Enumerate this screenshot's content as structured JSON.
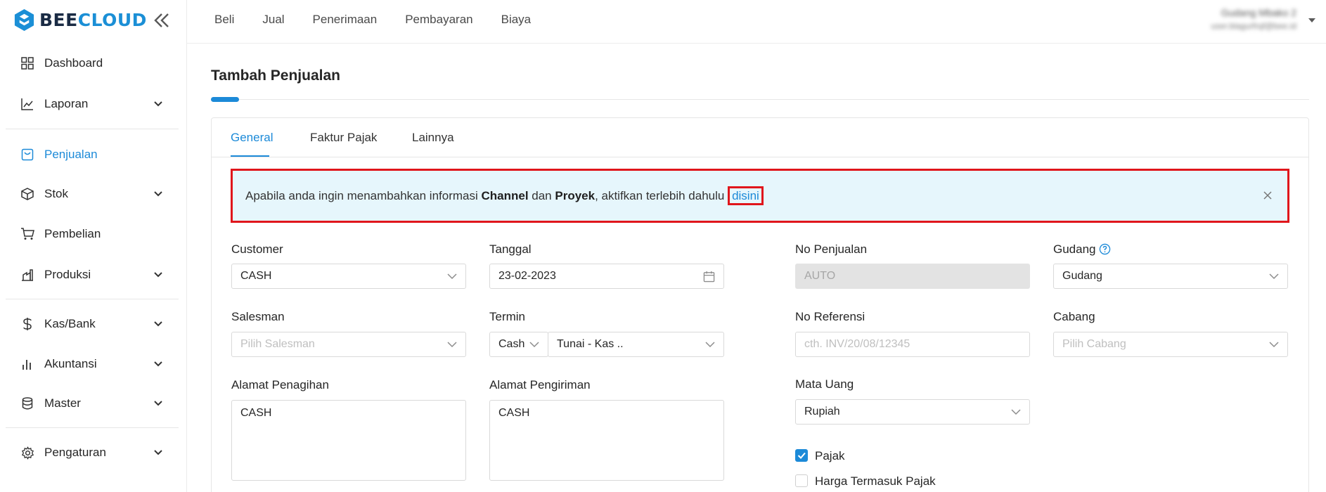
{
  "brand": {
    "part1": "BEE",
    "part2": "CLOUD",
    "color_dark": "#1a2b44",
    "color_accent": "#1b8fd6"
  },
  "sidebar": {
    "collapse_icon": "double-chevron-left-icon",
    "items": [
      {
        "label": "Dashboard",
        "icon": "grid-icon",
        "chevron": false
      },
      {
        "label": "Laporan",
        "icon": "line-chart-icon",
        "chevron": true
      },
      {
        "label": "Penjualan",
        "icon": "receipt-icon",
        "chevron": false,
        "active": true
      },
      {
        "label": "Stok",
        "icon": "box-icon",
        "chevron": true
      },
      {
        "label": "Pembelian",
        "icon": "cart-icon",
        "chevron": false
      },
      {
        "label": "Produksi",
        "icon": "factory-icon",
        "chevron": true
      },
      {
        "label": "Kas/Bank",
        "icon": "dollar-icon",
        "chevron": true
      },
      {
        "label": "Akuntansi",
        "icon": "bar-chart-icon",
        "chevron": true
      },
      {
        "label": "Master",
        "icon": "database-icon",
        "chevron": true
      },
      {
        "label": "Pengaturan",
        "icon": "gear-icon",
        "chevron": true
      }
    ]
  },
  "topmenu": {
    "items": [
      "Beli",
      "Jual",
      "Penerimaan",
      "Pembayaran",
      "Biaya"
    ]
  },
  "user": {
    "name": "Gudang Mbako 2",
    "email": "user.blagurfrqf@bee.id"
  },
  "page": {
    "title": "Tambah Penjualan"
  },
  "tabs": [
    "General",
    "Faktur Pajak",
    "Lainnya"
  ],
  "alert": {
    "part1": "Apabila anda ingin menambahkan informasi ",
    "bold1": "Channel",
    "part2": " dan ",
    "bold2": "Proyek",
    "part3": ", aktifkan terlebih dahulu ",
    "link": "disini",
    "highlight_color": "#e0161c",
    "background": "#e6f6fc"
  },
  "form": {
    "customer": {
      "label": "Customer",
      "value": "CASH"
    },
    "tanggal": {
      "label": "Tanggal",
      "value": "23-02-2023"
    },
    "no_penjualan": {
      "label": "No Penjualan",
      "value": "AUTO"
    },
    "gudang": {
      "label": "Gudang",
      "value": "Gudang"
    },
    "salesman": {
      "label": "Salesman",
      "placeholder": "Pilih Salesman"
    },
    "termin": {
      "label": "Termin",
      "type_value": "Cash",
      "account_value": "Tunai - Kas .."
    },
    "no_referensi": {
      "label": "No Referensi",
      "placeholder": "cth. INV/20/08/12345"
    },
    "cabang": {
      "label": "Cabang",
      "placeholder": "Pilih Cabang"
    },
    "alamat_penagihan": {
      "label": "Alamat Penagihan",
      "value": "CASH"
    },
    "alamat_pengiriman": {
      "label": "Alamat Pengiriman",
      "value": "CASH"
    },
    "mata_uang": {
      "label": "Mata Uang",
      "value": "Rupiah"
    },
    "pajak": {
      "label": "Pajak",
      "checked": true
    },
    "harga_termasuk_pajak": {
      "label": "Harga Termasuk Pajak",
      "checked": false
    }
  },
  "colors": {
    "primary": "#1c8ad8"
  }
}
